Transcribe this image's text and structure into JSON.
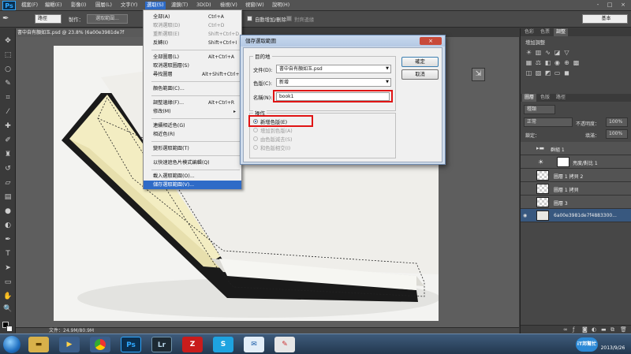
{
  "app": {
    "logo": "Ps",
    "menus": [
      "檔案(F)",
      "編輯(E)",
      "影像(I)",
      "圖層(L)",
      "文字(Y)",
      "選取(S)",
      "濾鏡(T)",
      "3D(D)",
      "檢視(V)",
      "視窗(W)",
      "說明(H)"
    ],
    "window_controls": [
      "-",
      "□",
      "×"
    ]
  },
  "options_bar": {
    "style_value": "一般",
    "style_label": "樣式",
    "selected_value": "路徑",
    "make_label": "製作：",
    "make_button": "選取範圍...",
    "auto_add_delete": "自動增加/刪除",
    "align_edges": "對齊邊緣",
    "workspace": "基本"
  },
  "document": {
    "tab_title": "書中自有顏如玉.psd @ 23.8% (6a00e3981de7f",
    "status": "文件：24.9M/80.9M"
  },
  "select_menu": {
    "items": [
      {
        "label": "全部(A)",
        "shortcut": "Ctrl+A"
      },
      {
        "label": "取消選取(D)",
        "shortcut": "Ctrl+D"
      },
      {
        "label": "重新選取(E)",
        "shortcut": "Shift+Ctrl+D"
      },
      {
        "label": "反轉(I)",
        "shortcut": "Shift+Ctrl+I"
      },
      {
        "label": "全部圖層(L)",
        "shortcut": "Alt+Ctrl+A"
      },
      {
        "label": "取消選取圖層(S)",
        "shortcut": ""
      },
      {
        "label": "尋找圖層",
        "shortcut": "Alt+Shift+Ctrl+F"
      },
      {
        "label": "顏色範圍(C)...",
        "shortcut": ""
      },
      {
        "label": "調整邊緣(F)...",
        "shortcut": "Alt+Ctrl+R"
      },
      {
        "label": "修改(M)",
        "shortcut": ""
      },
      {
        "label": "連續相近色(G)",
        "shortcut": ""
      },
      {
        "label": "相近色(R)",
        "shortcut": ""
      },
      {
        "label": "變形選取範圍(T)",
        "shortcut": ""
      },
      {
        "label": "以快速遮色片模式編輯(Q)",
        "shortcut": ""
      },
      {
        "label": "載入選取範圍(O)...",
        "shortcut": ""
      },
      {
        "label": "儲存選取範圍(V)...",
        "shortcut": ""
      }
    ]
  },
  "dialog": {
    "title": "儲存選取範圍",
    "close": "×",
    "destination_legend": "目的地",
    "document_label": "文件(D):",
    "document_value": "書中自有顏如玉.psd",
    "channel_label": "色版(C):",
    "channel_value": "新增",
    "name_label": "名稱(N):",
    "name_value": "book1",
    "operation_legend": "操作",
    "operations": [
      "新增色版(E)",
      "增加到色版(A)",
      "由色版減去(S)",
      "和色版相交(I)"
    ],
    "ok": "確定",
    "cancel": "取消"
  },
  "panels": {
    "top_tabs": [
      "色彩",
      "色票",
      "調整"
    ],
    "adjust_title": "增加調整",
    "layer_tabs": [
      "圖層",
      "色版",
      "路徑"
    ],
    "kind_value": "種類",
    "blend_mode": "正常",
    "opacity_label": "不透明度：",
    "opacity_value": "100%",
    "lock_label": "鎖定：",
    "fill_label": "填滿：",
    "fill_value": "100%",
    "layers": [
      {
        "name": "群組 1"
      },
      {
        "name": "亮度/對比 1"
      },
      {
        "name": "圖層 1 拷貝 2"
      },
      {
        "name": "圖層 1 拷貝"
      },
      {
        "name": "圖層 3"
      },
      {
        "name": "6a00e3981de7f4883300..."
      }
    ]
  },
  "taskbar": {
    "icons": [
      "folder",
      "media",
      "chrome",
      "Ps",
      "Lr",
      "FileZilla",
      "Skype",
      "Outlook",
      "Paint"
    ],
    "watermark": "iT邦幫忙",
    "date": "2013/9/26"
  }
}
